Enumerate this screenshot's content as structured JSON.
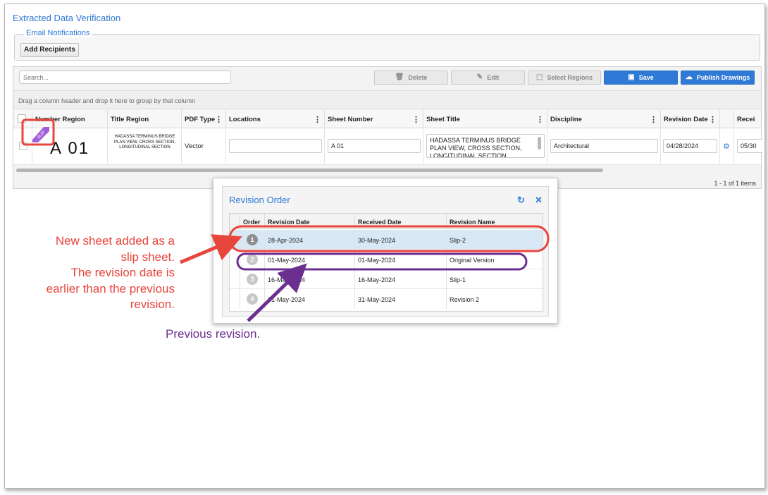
{
  "app": {
    "title": "Extracted Data Verification"
  },
  "email": {
    "legend": "Email Notifications",
    "add_button": "Add Recipients"
  },
  "toolbar": {
    "search_placeholder": "Search...",
    "delete": "Delete",
    "edit": "Edit",
    "select_regions": "Select Regions",
    "save": "Save",
    "publish": "Publish Drawings"
  },
  "grid": {
    "group_hint": "Drag a column header and drop it here to group by that column",
    "columns": [
      "Number Region",
      "Title Region",
      "PDF Type",
      "Locations",
      "Sheet Number",
      "Sheet Title",
      "Discipline",
      "Revision Date",
      "Recei"
    ],
    "row": {
      "slip_badge": "SLIP",
      "number_region_text": "A 01",
      "title_region_text": "HADASSA TERMINUS BRIDGE PLAN VIEW, CROSS SECTION, LONGITUDINAL SECTION",
      "pdf_type": "Vector",
      "locations": "",
      "sheet_number": "A 01",
      "sheet_title": "HADASSA TERMINUS BRIDGE PLAN VIEW, CROSS SECTION, LONGITUDINAL SECTION",
      "discipline": "Architectural",
      "revision_date": "04/28/2024",
      "received_date": "05/30"
    },
    "pager": "1 - 1 of 1 items"
  },
  "dialog": {
    "title": "Revision Order",
    "columns": [
      "Order",
      "Revision Date",
      "Received Date",
      "Revision Name"
    ],
    "rows": [
      {
        "order": "1",
        "revision_date": "28-Apr-2024",
        "received_date": "30-May-2024",
        "revision_name": "Slip-2"
      },
      {
        "order": "2",
        "revision_date": "01-May-2024",
        "received_date": "01-May-2024",
        "revision_name": "Original Version"
      },
      {
        "order": "3",
        "revision_date": "16-May-2024",
        "received_date": "16-May-2024",
        "revision_name": "Slip-1"
      },
      {
        "order": "4",
        "revision_date": "31-May-2024",
        "received_date": "31-May-2024",
        "revision_name": "Revision 2"
      }
    ]
  },
  "annotations": {
    "red_lines": [
      "New sheet added as a",
      "slip sheet.",
      "The revision date is",
      "earlier than the previous",
      "revision."
    ],
    "purple": "Previous revision."
  },
  "colors": {
    "accent": "#2f7ad6",
    "annotation_red": "#e8453c",
    "annotation_purple": "#6b2f8f"
  }
}
